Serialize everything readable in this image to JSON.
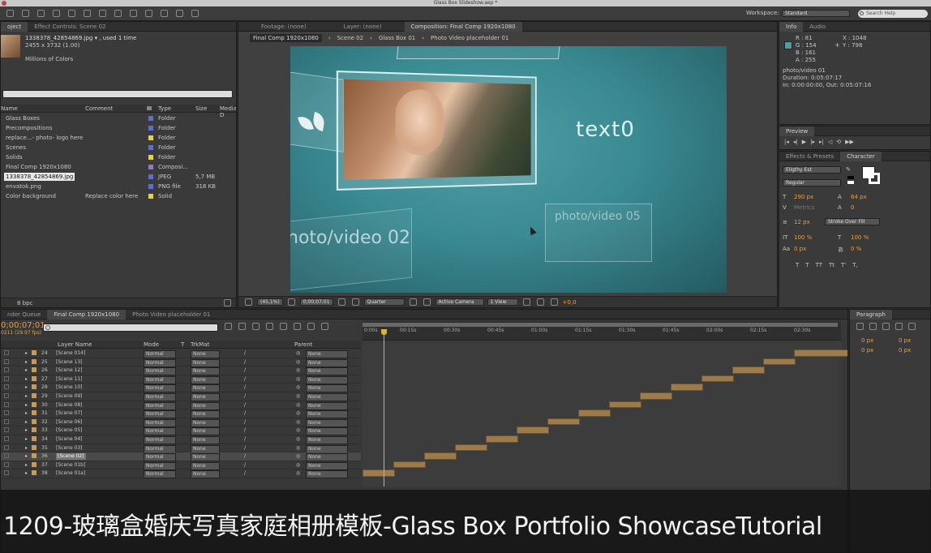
{
  "window": {
    "title": "Glass Box Slideshow.aep *"
  },
  "toolbar": {
    "workspace_label": "Workspace:",
    "workspace_value": "Standard",
    "search_placeholder": "Search Help"
  },
  "project": {
    "tab_project": "oject",
    "tab_effects": "Effect Controls: Scene 02",
    "file_name": "1338378_42854869.jpg ▾ , used 1 time",
    "file_dims": "2455 x 3732 (1.00)",
    "file_colors": "Millions of Colors",
    "columns": [
      "Name",
      "Comment",
      "Type",
      "Size",
      "Media D"
    ],
    "items": [
      {
        "name": "Glass Boxes",
        "comment": "",
        "color": "#5a6ed8",
        "type": "Folder",
        "size": ""
      },
      {
        "name": "Precompositions",
        "comment": "",
        "color": "#5a6ed8",
        "type": "Folder",
        "size": ""
      },
      {
        "name": "replace...- photo- logo here",
        "comment": "",
        "color": "#e6d23c",
        "type": "Folder",
        "size": ""
      },
      {
        "name": "Scenes",
        "comment": "",
        "color": "#5a6ed8",
        "type": "Folder",
        "size": ""
      },
      {
        "name": "Solids",
        "comment": "",
        "color": "#e6d23c",
        "type": "Folder",
        "size": ""
      },
      {
        "name": "Final Comp 1920x1080",
        "comment": "",
        "color": "#8a7ad0",
        "type": "Composi...",
        "size": ""
      },
      {
        "name": "1338378_42854869.jpg",
        "comment": "",
        "color": "#5a6ed8",
        "type": "JPEG",
        "size": "5,7 MB"
      },
      {
        "name": "envatok.png",
        "comment": "",
        "color": "#5a6ed8",
        "type": "PNG file",
        "size": "318 KB"
      },
      {
        "name": "Color background",
        "comment": "Replace color here",
        "color": "#e6d23c",
        "type": "Solid",
        "size": ""
      }
    ],
    "bpc": "8 bpc"
  },
  "composition": {
    "tab_footage": "Footage: (none)",
    "tab_layer": "Layer: (none)",
    "tab_comp": "Composition: Final Comp 1920x1080",
    "breadcrumbs": [
      "Final Comp 1920x1080",
      "Scene 02",
      "Glass Box 01",
      "Photo Video placeholder 01"
    ],
    "preview_text_main": "text0",
    "preview_text_left": "hoto/video 02",
    "preview_text_right": "photo/video 05",
    "zoom": "(45,1%)",
    "timecode": "0;00;07;01",
    "resolution": "Quarter",
    "camera": "Active Camera",
    "views": "1 View",
    "exposure": "+0,0"
  },
  "info": {
    "tab_info": "Info",
    "tab_audio": "Audio",
    "r": "R : 81",
    "g": "G : 154",
    "b": "B : 161",
    "a": "A : 255",
    "x": "X : 1048",
    "y": "Y : 798",
    "swatch": "#519aa1",
    "layer": "photo/video 01",
    "duration": "Duration: 0:05:07:17",
    "inout": "In: 0:00:00:00, Out: 0:05:07:16"
  },
  "preview": {
    "tab": "Preview"
  },
  "character": {
    "tab_effects": "Effects & Presets",
    "tab_character": "Character",
    "font": "Eligthy Est",
    "style": "Regular",
    "size": "290 px",
    "leading": "64 px",
    "kerning": "Metrics",
    "tracking": "0",
    "stroke_size": "12 px",
    "stroke_mode": "Stroke Over Fill",
    "vscale": "100 %",
    "hscale": "100 %",
    "baseline": "0 px",
    "tsume": "0 %",
    "styles": [
      "T",
      "T",
      "TT",
      "Tt",
      "T'",
      "T,"
    ]
  },
  "paragraph": {
    "tab": "Paragraph",
    "indent_left": "0 px",
    "indent_right": "0 px",
    "space_before": "0 px",
    "space_after": "0 px"
  },
  "timeline": {
    "tab_render": "nder Queue",
    "tab_comp": "Final Comp 1920x1080",
    "tab_placeholder": "Photo Video placeholder 01",
    "timecode": "0;00;07;01",
    "fps": "0211 (29.97 fps)",
    "search_placeholder": "",
    "columns": {
      "layer_name": "Layer Name",
      "mode": "Mode",
      "t": "T",
      "trkmat": "TrkMat",
      "parent": "Parent"
    },
    "ruler": [
      "0:00s",
      "00:15s",
      "00:30s",
      "00:45s",
      "01:00s",
      "01:15s",
      "01:30s",
      "01:45s",
      "02:00s",
      "02:15s",
      "02:30s"
    ],
    "layers": [
      {
        "num": "24",
        "name": "[Scene 014]",
        "mode": "Normal",
        "trkmat": "None",
        "parent": "None"
      },
      {
        "num": "25",
        "name": "[Scene 13]",
        "mode": "Normal",
        "trkmat": "None",
        "parent": "None"
      },
      {
        "num": "26",
        "name": "[Scene 12]",
        "mode": "Normal",
        "trkmat": "None",
        "parent": "None"
      },
      {
        "num": "27",
        "name": "[Scene 11]",
        "mode": "Normal",
        "trkmat": "None",
        "parent": "None"
      },
      {
        "num": "28",
        "name": "[Scene 10]",
        "mode": "Normal",
        "trkmat": "None",
        "parent": "None"
      },
      {
        "num": "29",
        "name": "[Scene 09]",
        "mode": "Normal",
        "trkmat": "None",
        "parent": "None"
      },
      {
        "num": "30",
        "name": "[Scene 08]",
        "mode": "Normal",
        "trkmat": "None",
        "parent": "None"
      },
      {
        "num": "31",
        "name": "[Scene 07]",
        "mode": "Normal",
        "trkmat": "None",
        "parent": "None"
      },
      {
        "num": "32",
        "name": "[Scene 06]",
        "mode": "Normal",
        "trkmat": "None",
        "parent": "None"
      },
      {
        "num": "33",
        "name": "[Scene 05]",
        "mode": "Normal",
        "trkmat": "None",
        "parent": "None"
      },
      {
        "num": "34",
        "name": "[Scene 04]",
        "mode": "Normal",
        "trkmat": "None",
        "parent": "None"
      },
      {
        "num": "35",
        "name": "[Scene 03]",
        "mode": "Normal",
        "trkmat": "None",
        "parent": "None"
      },
      {
        "num": "36",
        "name": "[Scene 02]",
        "mode": "Normal",
        "trkmat": "None",
        "parent": "None"
      },
      {
        "num": "37",
        "name": "[Scene 01b]",
        "mode": "Normal",
        "trkmat": "None",
        "parent": "None"
      },
      {
        "num": "38",
        "name": "[Scene 01a]",
        "mode": "Normal",
        "trkmat": "None",
        "parent": "None"
      }
    ]
  },
  "subtitle": {
    "text": "1209-玻璃盒婚庆写真家庭相册模板-Glass Box Portfolio ShowcaseTutorial"
  }
}
